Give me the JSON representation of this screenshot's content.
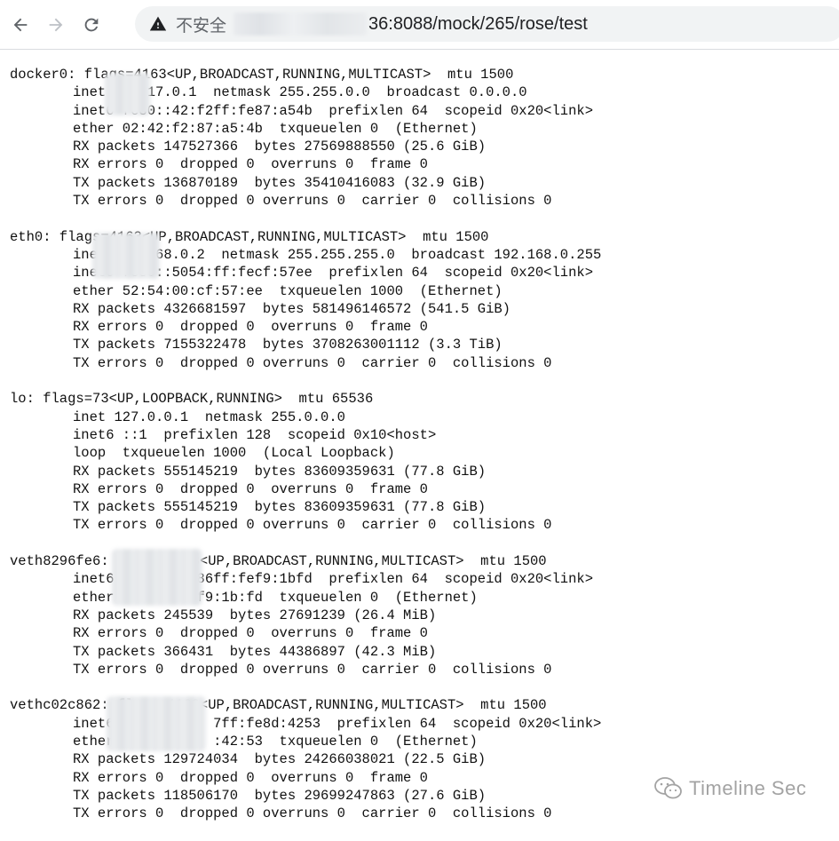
{
  "browser": {
    "security_label": "不安全",
    "url": "36:8088/mock/265/rose/test"
  },
  "output": {
    "interfaces": [
      {
        "header": "docker0: flags=4163<UP,BROADCAST,RUNNING,MULTICAST>  mtu 1500",
        "lines": [
          "inet 1  .17.0.1  netmask 255.255.0.0  broadcast 0.0.0.0",
          "inet6 fe80::42:f2ff:fe87:a54b  prefixlen 64  scopeid 0x20<link>",
          "ether 02:42:f2:87:a5:4b  txqueuelen 0  (Ethernet)",
          "RX packets 147527366  bytes 27569888550 (25.6 GiB)",
          "RX errors 0  dropped 0  overruns 0  frame 0",
          "TX packets 136870189  bytes 35410416083 (32.9 GiB)",
          "TX errors 0  dropped 0 overruns 0  carrier 0  collisions 0"
        ]
      },
      {
        "header": "eth0: flags=4163<UP,BROADCAST,RUNNING,MULTICAST>  mtu 1500",
        "lines": [
          "inet 1  .168.0.2  netmask 255.255.255.0  broadcast 192.168.0.255",
          "inet6 fe80::5054:ff:fecf:57ee  prefixlen 64  scopeid 0x20<link>",
          "ether 52:54:00:cf:57:ee  txqueuelen 1000  (Ethernet)",
          "RX packets 4326681597  bytes 581496146572 (541.5 GiB)",
          "RX errors 0  dropped 0  overruns 0  frame 0",
          "TX packets 7155322478  bytes 3708263001112 (3.3 TiB)",
          "TX errors 0  dropped 0 overruns 0  carrier 0  collisions 0"
        ]
      },
      {
        "header": "lo: flags=73<UP,LOOPBACK,RUNNING>  mtu 65536",
        "lines": [
          "inet 127.0.0.1  netmask 255.0.0.0",
          "inet6 ::1  prefixlen 128  scopeid 0x10<host>",
          "loop  txqueuelen 1000  (Local Loopback)",
          "RX packets 555145219  bytes 83609359631 (77.8 GiB)",
          "RX errors 0  dropped 0  overruns 0  frame 0",
          "TX packets 555145219  bytes 83609359631 (77.8 GiB)",
          "TX errors 0  dropped 0 overruns 0  carrier 0  collisions 0"
        ]
      },
      {
        "header": "veth8296fe6: flags=4163<UP,BROADCAST,RUNNING,MULTICAST>  mtu 1500",
        "lines": [
          "inet6 fe80::  :86ff:fef9:1bfd  prefixlen 64  scopeid 0x20<link>",
          "ether   :  :  :f9:1b:fd  txqueuelen 0  (Ethernet)",
          "RX packets 245539  bytes 27691239 (26.4 MiB)",
          "RX errors 0  dropped 0  overruns 0  frame 0",
          "TX packets 366431  bytes 44386897 (42.3 MiB)",
          "TX errors 0  dropped 0 overruns 0  carrier 0  collisions 0"
        ]
      },
      {
        "header": "vethc02c862: flags=4163<UP,BROADCAST,RUNNING,MULTICAST>  mtu 1500",
        "lines": [
          "inet6 fe80::  :  7ff:fe8d:4253  prefixlen 64  scopeid 0x20<link>",
          "ether   :  :  :  :42:53  txqueuelen 0  (Ethernet)",
          "RX packets 129724034  bytes 24266038021 (22.5 GiB)",
          "RX errors 0  dropped 0  overruns 0  frame 0",
          "TX packets 118506170  bytes 29699247863 (27.6 GiB)",
          "TX errors 0  dropped 0 overruns 0  carrier 0  collisions 0"
        ]
      }
    ]
  },
  "watermark": {
    "text": "Timeline Sec"
  }
}
